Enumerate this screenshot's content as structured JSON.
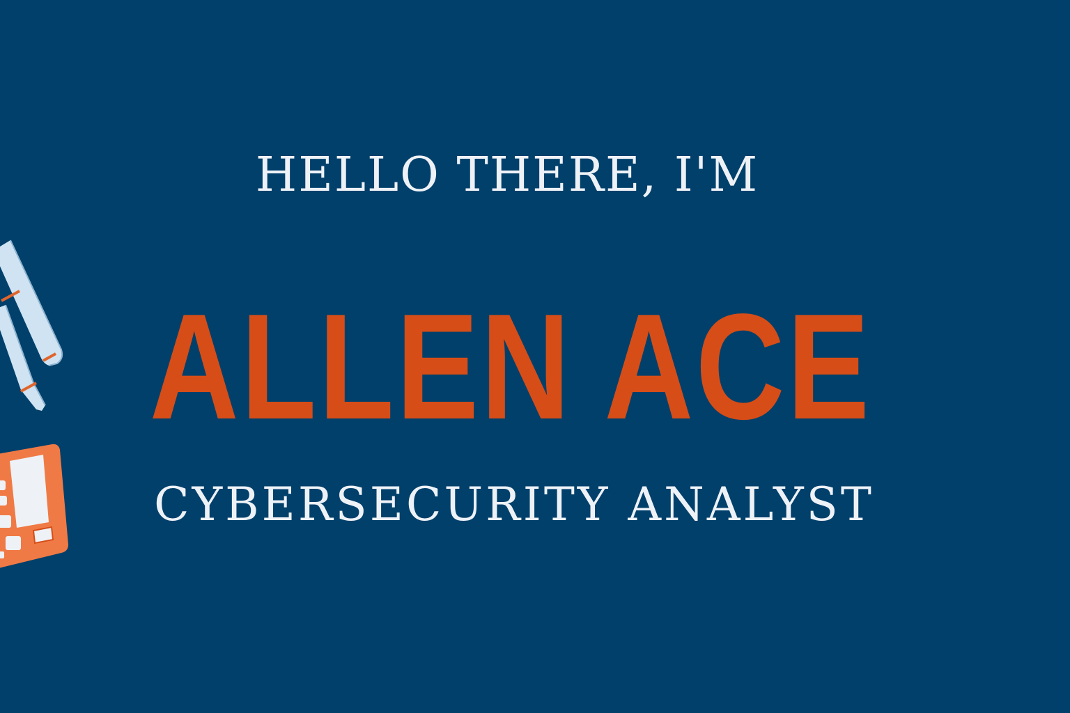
{
  "banner": {
    "greeting": "HELLO THERE, I'M",
    "name": "ALLEN ACE",
    "role": "CYBERSECURITY ANALYST"
  },
  "decorations": {
    "left_icons": [
      "pen-icon",
      "pen-icon",
      "calculator-icon"
    ]
  },
  "colors": {
    "background": "#00406b",
    "accent": "#d64d17",
    "text": "#eef2f7"
  }
}
